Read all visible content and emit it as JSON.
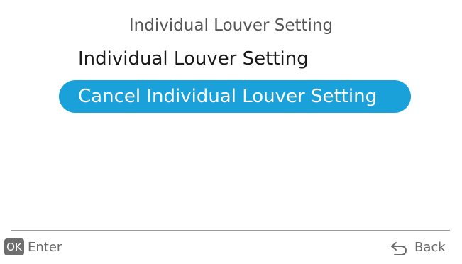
{
  "header": {
    "title": "Individual Louver Setting"
  },
  "menu": {
    "items": [
      {
        "label": "Individual Louver Setting",
        "selected": false
      },
      {
        "label": "Cancel Individual Louver Setting",
        "selected": true
      }
    ]
  },
  "footer": {
    "ok_badge": "OK",
    "enter_label": "Enter",
    "back_icon": "back-arrow-icon",
    "back_label": "Back"
  },
  "colors": {
    "highlight": "#1ba1d9",
    "divider": "#9a9a9a",
    "badge": "#6e6e6e"
  }
}
